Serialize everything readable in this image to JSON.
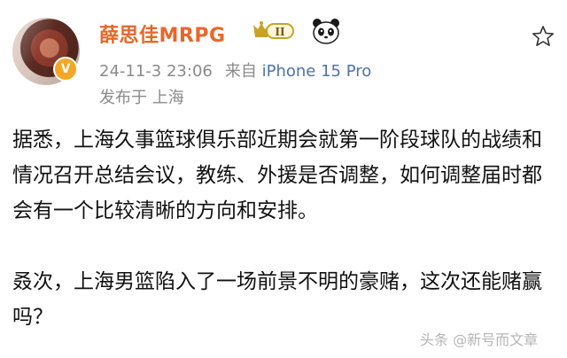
{
  "user": {
    "name": "薛思佳MRPG",
    "verified_badge": "V",
    "rank_badge": "II"
  },
  "post_meta": {
    "timestamp": "24-11-3 23:06",
    "source_prefix": "来自",
    "source_device": "iPhone 15 Pro",
    "location": "发布于 上海"
  },
  "post": {
    "paragraph_1": "据悉，上海久事篮球俱乐部近期会就第一阶段球队的战绩和情况召开总结会议，教练、外援是否调整，如何调整届时都会有一个比较清晰的方向和安排。",
    "paragraph_2": "叒次，上海男篮陷入了一场前景不明的豪赌，这次还能赌赢吗？"
  },
  "watermark": "头条 @新号而文章",
  "icons": [
    "avatar",
    "verified-badge-icon",
    "rank-badge-icon",
    "panda-icon",
    "favorite-star-icon"
  ],
  "colors": {
    "username": "#e8672a",
    "meta_text": "#8a8a8a",
    "device_link": "#4d74a8",
    "verified_badge": "#f5a623",
    "rank_badge": "#c9a227"
  }
}
